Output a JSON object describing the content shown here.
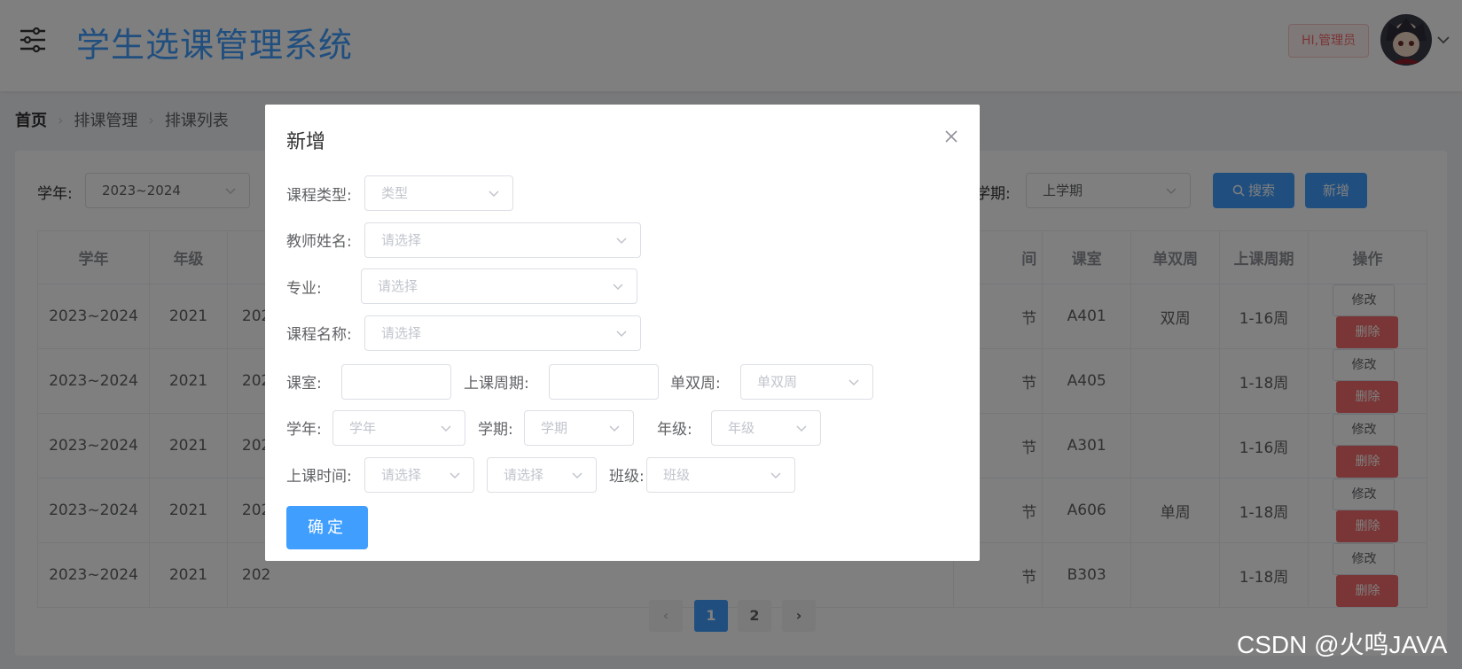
{
  "header": {
    "title": "学生选课管理系统",
    "greeting": "HI,管理员",
    "colors": {
      "primary": "#409eff",
      "danger": "#f56c6c"
    }
  },
  "breadcrumb": [
    "首页",
    "排课管理",
    "排课列表"
  ],
  "filters": {
    "year_label": "学年:",
    "year_value": "2023~2024",
    "semester_label": "学期:",
    "semester_value": "上学期",
    "search_label": "搜索",
    "add_label": "新增"
  },
  "table": {
    "headers": [
      "学年",
      "年级",
      "间",
      "课室",
      "单双周",
      "上课周期",
      "操作"
    ],
    "rows": [
      {
        "year": "2023~2024",
        "grade": "2021",
        "clip": "202",
        "time": "节",
        "room": "A401",
        "parity": "双周",
        "period": "1-16周"
      },
      {
        "year": "2023~2024",
        "grade": "2021",
        "clip": "202",
        "time": "节",
        "room": "A405",
        "parity": "",
        "period": "1-18周"
      },
      {
        "year": "2023~2024",
        "grade": "2021",
        "clip": "202",
        "time": "节",
        "room": "A301",
        "parity": "",
        "period": "1-16周"
      },
      {
        "year": "2023~2024",
        "grade": "2021",
        "clip": "202",
        "time": "节",
        "room": "A606",
        "parity": "单周",
        "period": "1-18周"
      },
      {
        "year": "2023~2024",
        "grade": "2021",
        "clip": "202",
        "time": "节",
        "room": "B303",
        "parity": "",
        "period": "1-18周"
      }
    ],
    "edit_label": "修改",
    "delete_label": "删除"
  },
  "pagination": {
    "prev": "‹",
    "pages": [
      "1",
      "2"
    ],
    "next": "›",
    "current": "1"
  },
  "modal": {
    "title": "新增",
    "course_type_label": "课程类型:",
    "course_type_placeholder": "类型",
    "teacher_label": "教师姓名:",
    "teacher_placeholder": "请选择",
    "major_label": "专业:",
    "major_placeholder": "请选择",
    "course_name_label": "课程名称:",
    "course_name_placeholder": "请选择",
    "classroom_label": "课室:",
    "period_label": "上课周期:",
    "parity_label": "单双周:",
    "parity_placeholder": "单双周",
    "year_label": "学年:",
    "year_placeholder": "学年",
    "semester_label": "学期:",
    "semester_placeholder": "学期",
    "grade_label": "年级:",
    "grade_placeholder": "年级",
    "time_label": "上课时间:",
    "time_placeholder_1": "请选择",
    "time_placeholder_2": "请选择",
    "class_label": "班级:",
    "class_placeholder": "班级",
    "confirm_label": "确定"
  },
  "watermark": "CSDN @火鸣JAVA"
}
